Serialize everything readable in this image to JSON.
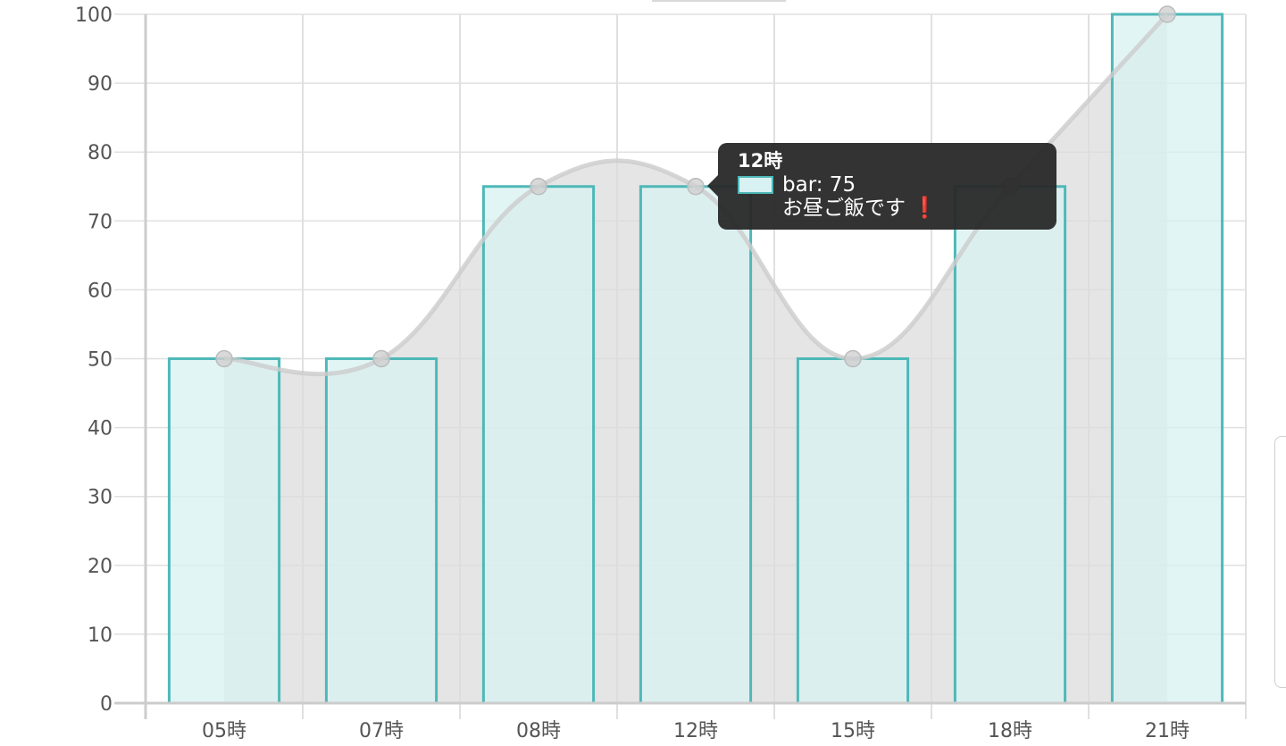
{
  "chart_data": {
    "type": "bar",
    "categories": [
      "05時",
      "07時",
      "08時",
      "12時",
      "15時",
      "18時",
      "21時"
    ],
    "series": [
      {
        "name": "bar",
        "type": "bar",
        "values": [
          50,
          50,
          75,
          75,
          50,
          75,
          100
        ]
      },
      {
        "type": "line",
        "values": [
          50,
          50,
          75,
          75,
          50,
          75,
          100
        ]
      }
    ],
    "ylim": [
      0,
      100
    ],
    "yticks": [
      0,
      10,
      20,
      30,
      40,
      50,
      60,
      70,
      80,
      90,
      100
    ],
    "grid": true,
    "colors": {
      "bar_fill": "#d8f1f2",
      "bar_stroke": "#4fb8b8",
      "area_fill": "#dcdcdc",
      "line": "#cccccc",
      "grid": "#e0e0e0",
      "axis": "#cccccc"
    }
  },
  "tooltip": {
    "title": "12時",
    "label": "bar: 75",
    "note": "お昼ご飯です",
    "icon": "exclamation-icon",
    "icon_glyph": "❗"
  }
}
